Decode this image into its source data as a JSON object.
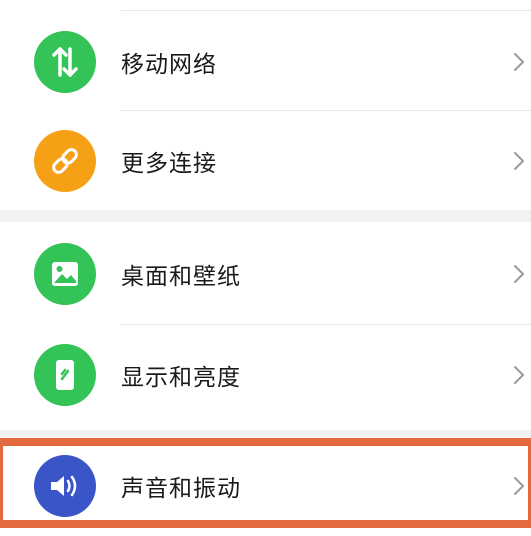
{
  "settings": {
    "items": [
      {
        "label": "移动网络",
        "icon": "mobile-data-icon",
        "color": "#33c357"
      },
      {
        "label": "更多连接",
        "icon": "link-icon",
        "color": "#f6a016"
      },
      {
        "label": "桌面和壁纸",
        "icon": "wallpaper-icon",
        "color": "#33c357"
      },
      {
        "label": "显示和亮度",
        "icon": "display-brightness-icon",
        "color": "#33c357"
      },
      {
        "label": "声音和振动",
        "icon": "speaker-icon",
        "color": "#3a55c8"
      }
    ],
    "highlight_color": "#e36a3f"
  }
}
